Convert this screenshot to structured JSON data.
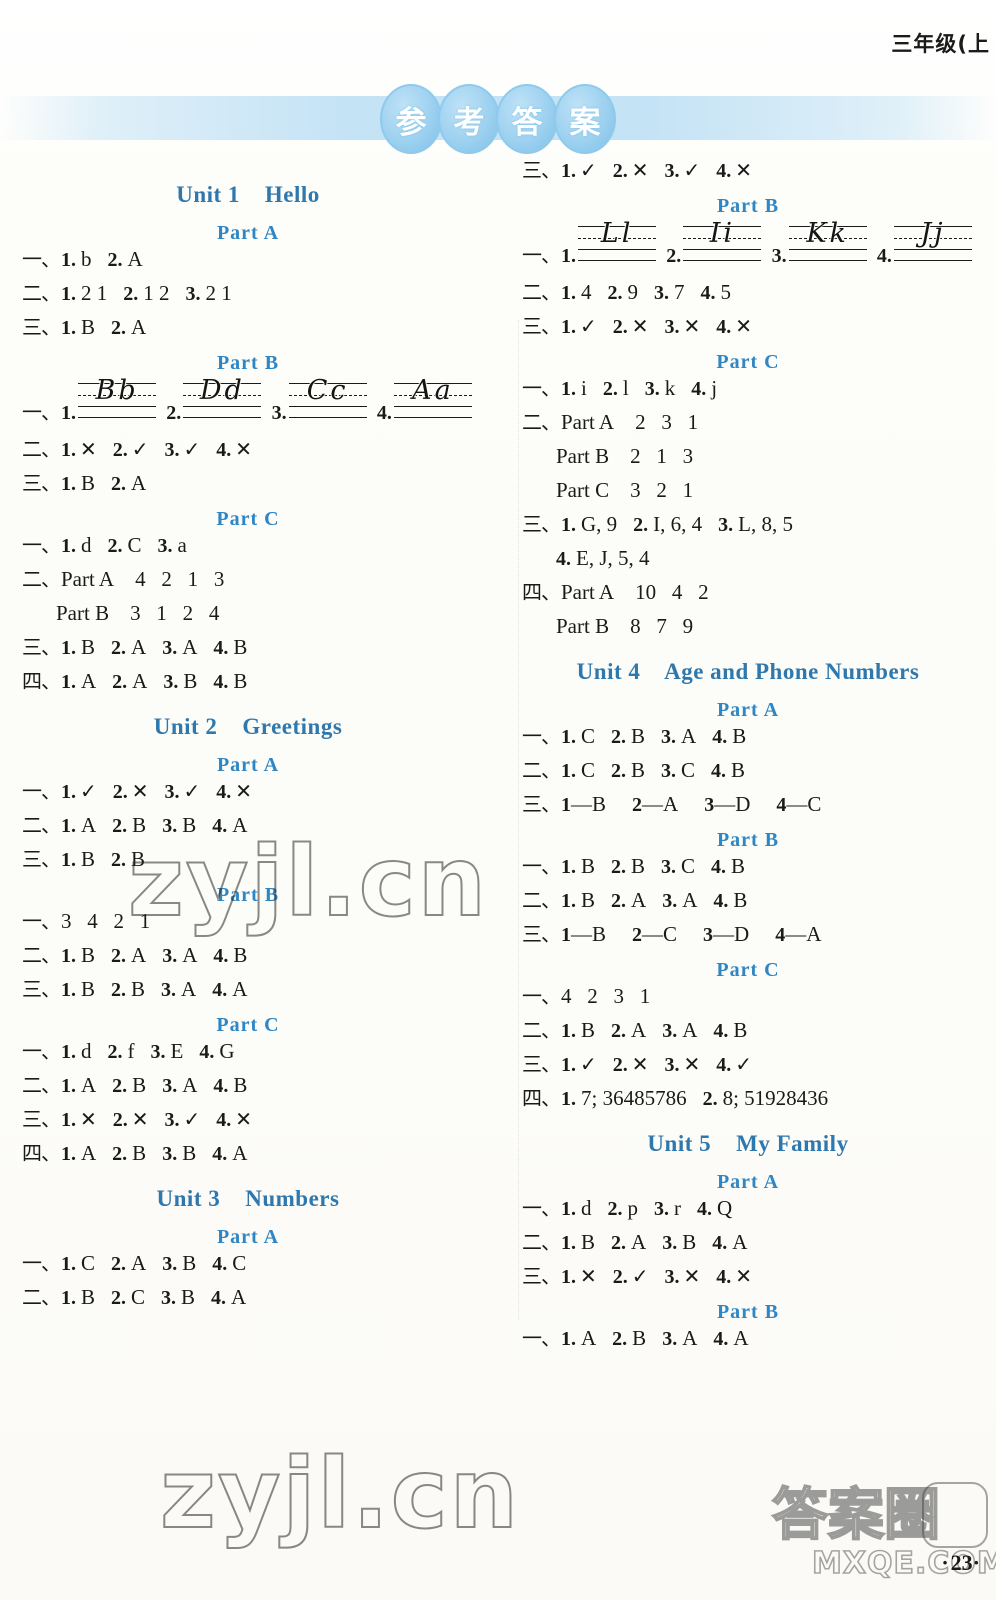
{
  "page": {
    "running_head": "三年级(上",
    "banner_title_chars": [
      "参",
      "考",
      "答",
      "案"
    ],
    "page_number": "23",
    "watermarks": [
      "zyjl.cn",
      "zyjl.cn",
      "答案圈",
      "MXQE.COM"
    ]
  },
  "left_column": [
    {
      "type": "unit",
      "label": "Unit 1    Hello"
    },
    {
      "type": "part",
      "label": "Part A"
    },
    {
      "type": "row",
      "rn": "一、",
      "items": [
        {
          "q": "1.",
          "a": "b"
        },
        {
          "q": "2.",
          "a": "A"
        }
      ]
    },
    {
      "type": "row",
      "rn": "二、",
      "items": [
        {
          "q": "1.",
          "a": "2 1"
        },
        {
          "q": "2.",
          "a": "1 2"
        },
        {
          "q": "3.",
          "a": "2 1"
        }
      ]
    },
    {
      "type": "row",
      "rn": "三、",
      "items": [
        {
          "q": "1.",
          "a": "B"
        },
        {
          "q": "2.",
          "a": "A"
        }
      ]
    },
    {
      "type": "part",
      "label": "Part B"
    },
    {
      "type": "hwrow",
      "rn": "一、",
      "items": [
        {
          "q": "1.",
          "glyph": "Bb"
        },
        {
          "q": "2.",
          "glyph": "Dd"
        },
        {
          "q": "3.",
          "glyph": "Cc"
        },
        {
          "q": "4.",
          "glyph": "Aa"
        }
      ]
    },
    {
      "type": "row",
      "rn": "二、",
      "items": [
        {
          "q": "1.",
          "a": "✕"
        },
        {
          "q": "2.",
          "a": "✓"
        },
        {
          "q": "3.",
          "a": "✓"
        },
        {
          "q": "4.",
          "a": "✕"
        }
      ]
    },
    {
      "type": "row",
      "rn": "三、",
      "items": [
        {
          "q": "1.",
          "a": "B"
        },
        {
          "q": "2.",
          "a": "A"
        }
      ]
    },
    {
      "type": "part",
      "label": "Part C"
    },
    {
      "type": "row",
      "rn": "一、",
      "items": [
        {
          "q": "1.",
          "a": "d"
        },
        {
          "q": "2.",
          "a": "C"
        },
        {
          "q": "3.",
          "a": "a"
        }
      ]
    },
    {
      "type": "subrow",
      "rn": "二、",
      "label": "Part A",
      "values": "4   2   1   3"
    },
    {
      "type": "subrow",
      "rn": "",
      "label": "Part B",
      "values": "3   1   2   4"
    },
    {
      "type": "row",
      "rn": "三、",
      "items": [
        {
          "q": "1.",
          "a": "B"
        },
        {
          "q": "2.",
          "a": "A"
        },
        {
          "q": "3.",
          "a": "A"
        },
        {
          "q": "4.",
          "a": "B"
        }
      ]
    },
    {
      "type": "row",
      "rn": "四、",
      "items": [
        {
          "q": "1.",
          "a": "A"
        },
        {
          "q": "2.",
          "a": "A"
        },
        {
          "q": "3.",
          "a": "B"
        },
        {
          "q": "4.",
          "a": "B"
        }
      ]
    },
    {
      "type": "unit",
      "label": "Unit 2    Greetings"
    },
    {
      "type": "part",
      "label": "Part A"
    },
    {
      "type": "row",
      "rn": "一、",
      "items": [
        {
          "q": "1.",
          "a": "✓"
        },
        {
          "q": "2.",
          "a": "✕"
        },
        {
          "q": "3.",
          "a": "✓"
        },
        {
          "q": "4.",
          "a": "✕"
        }
      ]
    },
    {
      "type": "row",
      "rn": "二、",
      "items": [
        {
          "q": "1.",
          "a": "A"
        },
        {
          "q": "2.",
          "a": "B"
        },
        {
          "q": "3.",
          "a": "B"
        },
        {
          "q": "4.",
          "a": "A"
        }
      ]
    },
    {
      "type": "row",
      "rn": "三、",
      "items": [
        {
          "q": "1.",
          "a": "B"
        },
        {
          "q": "2.",
          "a": "B"
        }
      ]
    },
    {
      "type": "part",
      "label": "Part B"
    },
    {
      "type": "plainrow",
      "rn": "一、",
      "values": "3   4   2   1"
    },
    {
      "type": "row",
      "rn": "二、",
      "items": [
        {
          "q": "1.",
          "a": "B"
        },
        {
          "q": "2.",
          "a": "A"
        },
        {
          "q": "3.",
          "a": "A"
        },
        {
          "q": "4.",
          "a": "B"
        }
      ]
    },
    {
      "type": "row",
      "rn": "三、",
      "items": [
        {
          "q": "1.",
          "a": "B"
        },
        {
          "q": "2.",
          "a": "B"
        },
        {
          "q": "3.",
          "a": "A"
        },
        {
          "q": "4.",
          "a": "A"
        }
      ]
    },
    {
      "type": "part",
      "label": "Part C"
    },
    {
      "type": "row",
      "rn": "一、",
      "items": [
        {
          "q": "1.",
          "a": "d"
        },
        {
          "q": "2.",
          "a": "f"
        },
        {
          "q": "3.",
          "a": "E"
        },
        {
          "q": "4.",
          "a": "G"
        }
      ]
    },
    {
      "type": "row",
      "rn": "二、",
      "items": [
        {
          "q": "1.",
          "a": "A"
        },
        {
          "q": "2.",
          "a": "B"
        },
        {
          "q": "3.",
          "a": "A"
        },
        {
          "q": "4.",
          "a": "B"
        }
      ]
    },
    {
      "type": "row",
      "rn": "三、",
      "items": [
        {
          "q": "1.",
          "a": "✕"
        },
        {
          "q": "2.",
          "a": "✕"
        },
        {
          "q": "3.",
          "a": "✓"
        },
        {
          "q": "4.",
          "a": "✕"
        }
      ]
    },
    {
      "type": "row",
      "rn": "四、",
      "items": [
        {
          "q": "1.",
          "a": "A"
        },
        {
          "q": "2.",
          "a": "B"
        },
        {
          "q": "3.",
          "a": "B"
        },
        {
          "q": "4.",
          "a": "A"
        }
      ]
    },
    {
      "type": "unit",
      "label": "Unit 3    Numbers"
    },
    {
      "type": "part",
      "label": "Part A"
    },
    {
      "type": "row",
      "rn": "一、",
      "items": [
        {
          "q": "1.",
          "a": "C"
        },
        {
          "q": "2.",
          "a": "A"
        },
        {
          "q": "3.",
          "a": "B"
        },
        {
          "q": "4.",
          "a": "C"
        }
      ]
    },
    {
      "type": "row",
      "rn": "二、",
      "items": [
        {
          "q": "1.",
          "a": "B"
        },
        {
          "q": "2.",
          "a": "C"
        },
        {
          "q": "3.",
          "a": "B"
        },
        {
          "q": "4.",
          "a": "A"
        }
      ]
    }
  ],
  "right_column": [
    {
      "type": "row",
      "rn": "三、",
      "items": [
        {
          "q": "1.",
          "a": "✓"
        },
        {
          "q": "2.",
          "a": "✕"
        },
        {
          "q": "3.",
          "a": "✓"
        },
        {
          "q": "4.",
          "a": "✕"
        }
      ]
    },
    {
      "type": "part",
      "label": "Part B"
    },
    {
      "type": "hwrow",
      "rn": "一、",
      "items": [
        {
          "q": "1.",
          "glyph": "Ll"
        },
        {
          "q": "2.",
          "glyph": "Ii"
        },
        {
          "q": "3.",
          "glyph": "Kk"
        },
        {
          "q": "4.",
          "glyph": "Jj"
        }
      ]
    },
    {
      "type": "row",
      "rn": "二、",
      "items": [
        {
          "q": "1.",
          "a": "4"
        },
        {
          "q": "2.",
          "a": "9"
        },
        {
          "q": "3.",
          "a": "7"
        },
        {
          "q": "4.",
          "a": "5"
        }
      ]
    },
    {
      "type": "row",
      "rn": "三、",
      "items": [
        {
          "q": "1.",
          "a": "✓"
        },
        {
          "q": "2.",
          "a": "✕"
        },
        {
          "q": "3.",
          "a": "✕"
        },
        {
          "q": "4.",
          "a": "✕"
        }
      ]
    },
    {
      "type": "part",
      "label": "Part C"
    },
    {
      "type": "row",
      "rn": "一、",
      "items": [
        {
          "q": "1.",
          "a": "i"
        },
        {
          "q": "2.",
          "a": "l"
        },
        {
          "q": "3.",
          "a": "k"
        },
        {
          "q": "4.",
          "a": "j"
        }
      ]
    },
    {
      "type": "subrow",
      "rn": "二、",
      "label": "Part A",
      "values": "2   3   1"
    },
    {
      "type": "subrow",
      "rn": "",
      "label": "Part B",
      "values": "2   1   3"
    },
    {
      "type": "subrow",
      "rn": "",
      "label": "Part C",
      "values": "3   2   1"
    },
    {
      "type": "row",
      "rn": "三、",
      "items": [
        {
          "q": "1.",
          "a": "G, 9"
        },
        {
          "q": "2.",
          "a": "I, 6, 4"
        },
        {
          "q": "3.",
          "a": "L, 8, 5"
        }
      ]
    },
    {
      "type": "controw",
      "indent": true,
      "items": [
        {
          "q": "4.",
          "a": "E, J, 5, 4"
        }
      ]
    },
    {
      "type": "subrow",
      "rn": "四、",
      "label": "Part A",
      "values": "10   4   2"
    },
    {
      "type": "subrow",
      "rn": "",
      "label": "Part B",
      "values": "8   7   9"
    },
    {
      "type": "unit",
      "label": "Unit 4    Age and Phone Numbers"
    },
    {
      "type": "part",
      "label": "Part A"
    },
    {
      "type": "row",
      "rn": "一、",
      "items": [
        {
          "q": "1.",
          "a": "C"
        },
        {
          "q": "2.",
          "a": "B"
        },
        {
          "q": "3.",
          "a": "A"
        },
        {
          "q": "4.",
          "a": "B"
        }
      ]
    },
    {
      "type": "row",
      "rn": "二、",
      "items": [
        {
          "q": "1.",
          "a": "C"
        },
        {
          "q": "2.",
          "a": "B"
        },
        {
          "q": "3.",
          "a": "C"
        },
        {
          "q": "4.",
          "a": "B"
        }
      ]
    },
    {
      "type": "matchrow",
      "rn": "三、",
      "items": [
        {
          "q": "1",
          "a": "—B"
        },
        {
          "q": "2",
          "a": "—A"
        },
        {
          "q": "3",
          "a": "—D"
        },
        {
          "q": "4",
          "a": "—C"
        }
      ]
    },
    {
      "type": "part",
      "label": "Part B"
    },
    {
      "type": "row",
      "rn": "一、",
      "items": [
        {
          "q": "1.",
          "a": "B"
        },
        {
          "q": "2.",
          "a": "B"
        },
        {
          "q": "3.",
          "a": "C"
        },
        {
          "q": "4.",
          "a": "B"
        }
      ]
    },
    {
      "type": "row",
      "rn": "二、",
      "items": [
        {
          "q": "1.",
          "a": "B"
        },
        {
          "q": "2.",
          "a": "A"
        },
        {
          "q": "3.",
          "a": "A"
        },
        {
          "q": "4.",
          "a": "B"
        }
      ]
    },
    {
      "type": "matchrow",
      "rn": "三、",
      "items": [
        {
          "q": "1",
          "a": "—B"
        },
        {
          "q": "2",
          "a": "—C"
        },
        {
          "q": "3",
          "a": "—D"
        },
        {
          "q": "4",
          "a": "—A"
        }
      ]
    },
    {
      "type": "part",
      "label": "Part C"
    },
    {
      "type": "plainrow",
      "rn": "一、",
      "values": "4   2   3   1"
    },
    {
      "type": "row",
      "rn": "二、",
      "items": [
        {
          "q": "1.",
          "a": "B"
        },
        {
          "q": "2.",
          "a": "A"
        },
        {
          "q": "3.",
          "a": "A"
        },
        {
          "q": "4.",
          "a": "B"
        }
      ]
    },
    {
      "type": "row",
      "rn": "三、",
      "items": [
        {
          "q": "1.",
          "a": "✓"
        },
        {
          "q": "2.",
          "a": "✕"
        },
        {
          "q": "3.",
          "a": "✕"
        },
        {
          "q": "4.",
          "a": "✓"
        }
      ]
    },
    {
      "type": "row",
      "rn": "四、",
      "items": [
        {
          "q": "1.",
          "a": "7; 36485786"
        },
        {
          "q": "2.",
          "a": "8; 51928436"
        }
      ]
    },
    {
      "type": "unit",
      "label": "Unit 5    My Family"
    },
    {
      "type": "part",
      "label": "Part A"
    },
    {
      "type": "row",
      "rn": "一、",
      "items": [
        {
          "q": "1.",
          "a": "d"
        },
        {
          "q": "2.",
          "a": "p"
        },
        {
          "q": "3.",
          "a": "r"
        },
        {
          "q": "4.",
          "a": "Q"
        }
      ]
    },
    {
      "type": "row",
      "rn": "二、",
      "items": [
        {
          "q": "1.",
          "a": "B"
        },
        {
          "q": "2.",
          "a": "A"
        },
        {
          "q": "3.",
          "a": "B"
        },
        {
          "q": "4.",
          "a": "A"
        }
      ]
    },
    {
      "type": "row",
      "rn": "三、",
      "items": [
        {
          "q": "1.",
          "a": "✕"
        },
        {
          "q": "2.",
          "a": "✓"
        },
        {
          "q": "3.",
          "a": "✕"
        },
        {
          "q": "4.",
          "a": "✕"
        }
      ]
    },
    {
      "type": "part",
      "label": "Part B"
    },
    {
      "type": "row",
      "rn": "一、",
      "items": [
        {
          "q": "1.",
          "a": "A"
        },
        {
          "q": "2.",
          "a": "B"
        },
        {
          "q": "3.",
          "a": "A"
        },
        {
          "q": "4.",
          "a": "A"
        }
      ]
    }
  ]
}
